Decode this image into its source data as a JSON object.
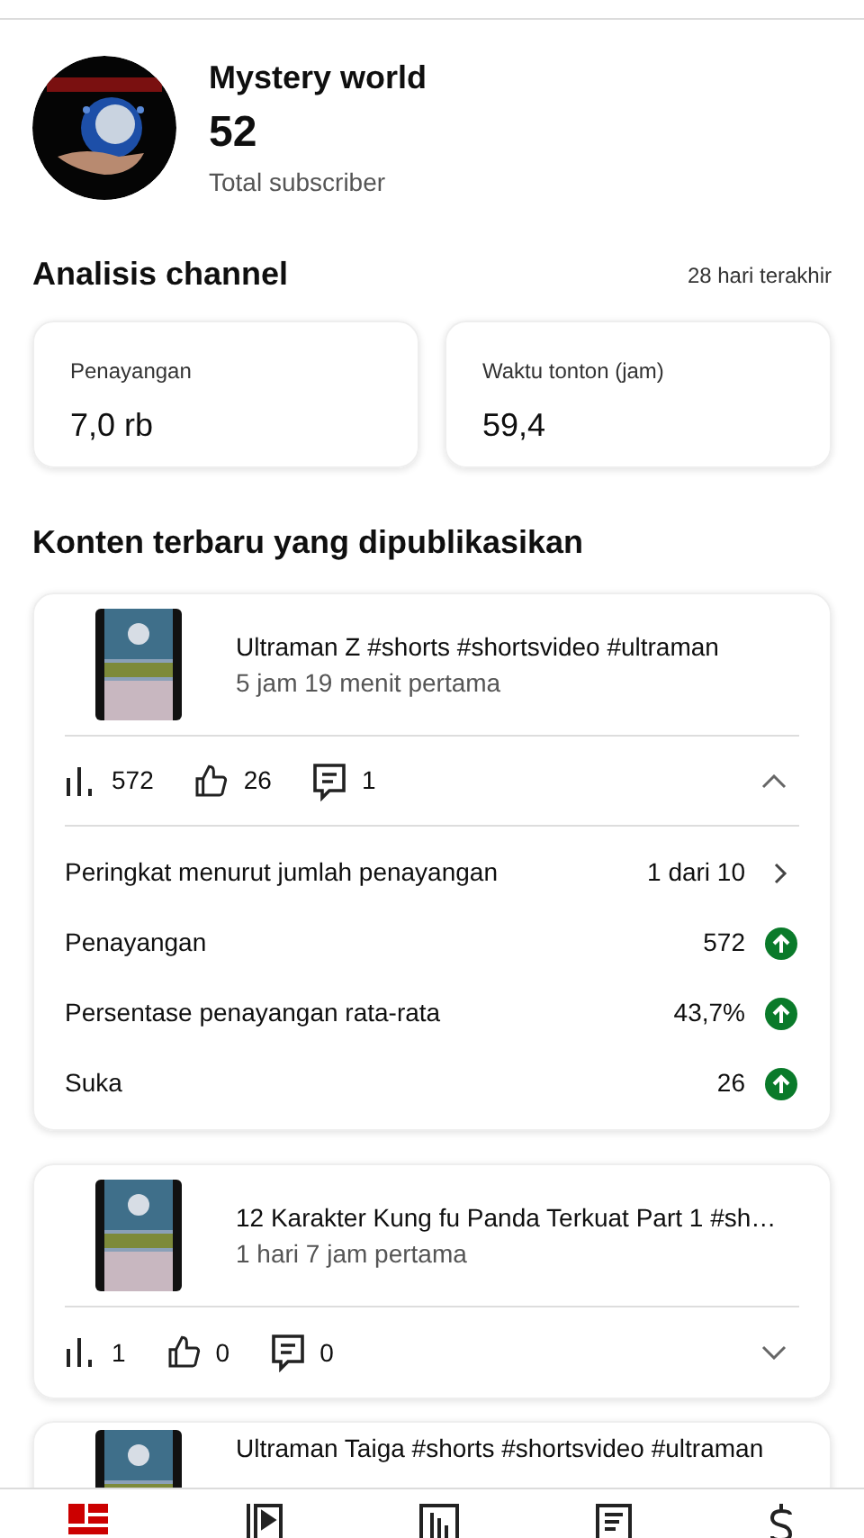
{
  "channel": {
    "name": "Mystery world",
    "subscribers": "52",
    "subscribers_label": "Total subscriber"
  },
  "analytics": {
    "title": "Analisis channel",
    "period": "28 hari terakhir",
    "cards": [
      {
        "label": "Penayangan",
        "value": "7,0 rb"
      },
      {
        "label": "Waktu tonton (jam)",
        "value": "59,4"
      }
    ]
  },
  "latest": {
    "title": "Konten terbaru yang dipublikasikan",
    "videos": [
      {
        "title": "Ultraman Z #shorts #shortsvideo #ultraman",
        "age": "5 jam 19 menit pertama",
        "views": "572",
        "likes": "26",
        "comments": "1",
        "expanded": true,
        "details": [
          {
            "kind": "rank",
            "label": "Peringkat menurut jumlah penayangan",
            "value": "1 dari 10"
          },
          {
            "kind": "metric",
            "label": "Penayangan",
            "value": "572"
          },
          {
            "kind": "metric",
            "label": "Persentase penayangan rata-rata",
            "value": "43,7%"
          },
          {
            "kind": "metric",
            "label": "Suka",
            "value": "26"
          }
        ]
      },
      {
        "title": "12 Karakter Kung fu Panda Terkuat Part 1 #sh…",
        "age": "1 hari 7 jam pertama",
        "views": "1",
        "likes": "0",
        "comments": "0",
        "expanded": false
      },
      {
        "title": "Ultraman Taiga #shorts #shortsvideo #ultraman"
      }
    ]
  },
  "bottom_nav": [
    {
      "selected": true
    },
    {
      "selected": false
    },
    {
      "selected": false
    },
    {
      "selected": false
    },
    {
      "selected": false
    }
  ]
}
